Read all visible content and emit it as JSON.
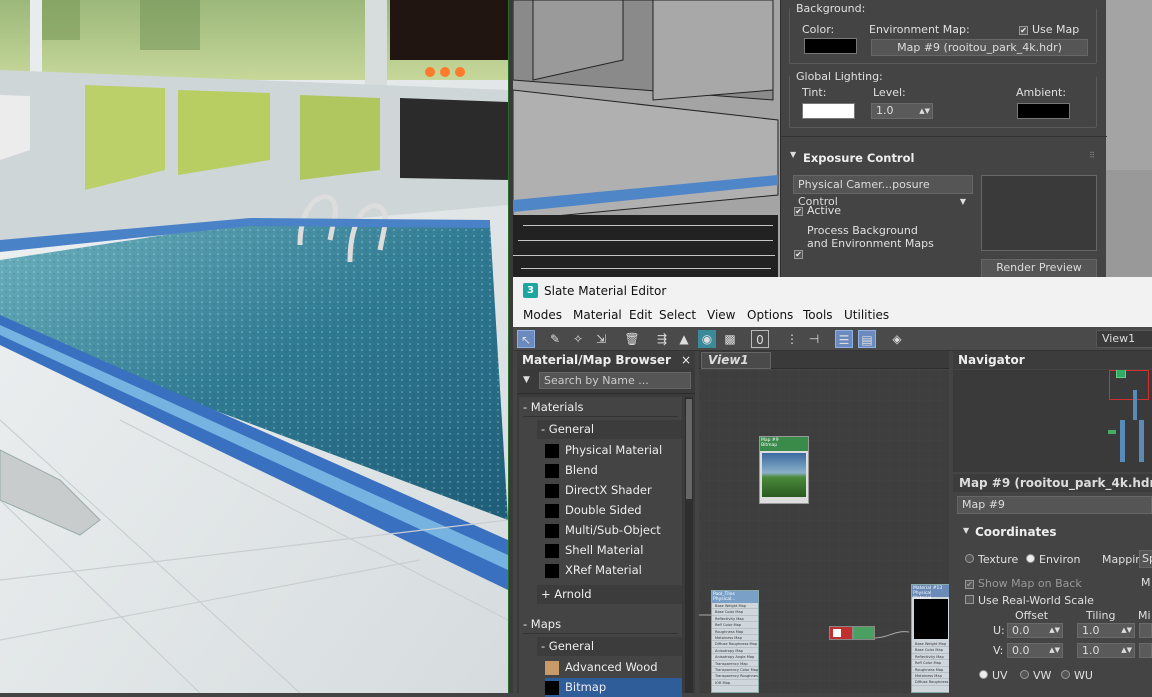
{
  "env_panel": {
    "background_label": "Background:",
    "color_label": "Color:",
    "env_map_label": "Environment Map:",
    "use_map_label": "Use Map",
    "env_map_button": "Map #9 (rooitou_park_4k.hdr)",
    "global_lighting_label": "Global Lighting:",
    "tint_label": "Tint:",
    "level_label": "Level:",
    "level_value": "1.0",
    "ambient_label": "Ambient:",
    "exposure_header": "Exposure Control",
    "exposure_dropdown": "Physical Camer...posure Control",
    "active_label": "Active",
    "process_bg_line1": "Process Background",
    "process_bg_line2": "and Environment Maps",
    "render_preview_button": "Render Preview"
  },
  "slate": {
    "title": "Slate Material Editor",
    "app_icon": "3",
    "menu": [
      "Modes",
      "Material",
      "Edit",
      "Select",
      "View",
      "Options",
      "Tools",
      "Utilities"
    ],
    "view_select": "View1",
    "browser": {
      "title": "Material/Map Browser",
      "search_placeholder": "Search by Name ...",
      "materials_label": "- Materials",
      "general_label": "- General",
      "materials": [
        "Physical Material",
        "Blend",
        "DirectX Shader",
        "Double Sided",
        "Multi/Sub-Object",
        "Shell Material",
        "XRef Material"
      ],
      "arnold_label": "+ Arnold",
      "maps_label": "- Maps",
      "maps_general_label": "- General",
      "maps": [
        "Advanced Wood",
        "Bitmap"
      ]
    },
    "view_tab": "View1",
    "nodes": {
      "bitmap_title": "Map #9",
      "bitmap_sub": "Bitmap",
      "phys1_title": "Pool_Tiles",
      "phys1_sub": "Physical...",
      "phys2_title": "Material #13",
      "phys2_sub": "Physical Material",
      "phys1_slots": [
        "Base Weight Map",
        "Base Color Map",
        "Reflectivity Map",
        "Refl Color Map",
        "Roughness Map",
        "Metalness Map",
        "Diffuse Roughness Map",
        "Anisotropy Map",
        "Anisotropy Angle Map",
        "Transparency Map",
        "Transparency Color Map",
        "Transparency Roughness Map",
        "IOR Map"
      ],
      "phys2_slots": [
        "Base Weight Map",
        "Base Color Map",
        "Reflectivity Map",
        "Refl Color Map",
        "Roughness Map",
        "Metalness Map",
        "Diffuse Roughness Map"
      ]
    },
    "navigator_title": "Navigator",
    "params": {
      "title": "Map #9 (rooitou_park_4k.hdr)",
      "name_value": "Map #9",
      "coords_header": "Coordinates",
      "texture_label": "Texture",
      "environ_label": "Environ",
      "mapping_label": "Mapping:",
      "mapping_value": "Sp",
      "show_map_back": "Show Map on Back",
      "m_trunc": "M",
      "real_world": "Use Real-World Scale",
      "offset_label": "Offset",
      "tiling_label": "Tiling",
      "mi_trunc": "Mi",
      "u_label": "U:",
      "v_label": "V:",
      "u_offset": "0.0",
      "v_offset": "0.0",
      "u_tiling": "1.0",
      "v_tiling": "1.0",
      "uv_label": "UV",
      "vw_label": "VW",
      "wu_label": "WU"
    }
  }
}
